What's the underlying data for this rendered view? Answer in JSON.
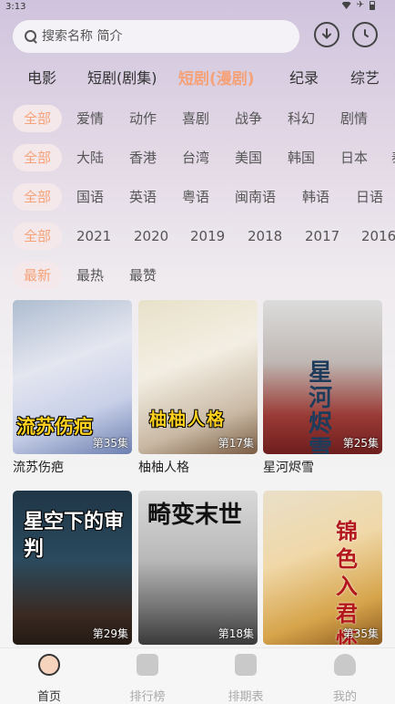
{
  "status": {
    "time": "3:13"
  },
  "search": {
    "placeholder": "搜索名称 简介"
  },
  "categories": [
    "电影",
    "短剧(剧集)",
    "短剧(漫剧)",
    "纪录",
    "综艺"
  ],
  "filters": {
    "genre": [
      "全部",
      "爱情",
      "动作",
      "喜剧",
      "战争",
      "科幻",
      "剧情"
    ],
    "region": [
      "全部",
      "大陆",
      "香港",
      "台湾",
      "美国",
      "韩国",
      "日本",
      "泰"
    ],
    "language": [
      "全部",
      "国语",
      "英语",
      "粤语",
      "闽南语",
      "韩语",
      "日语"
    ],
    "year": [
      "全部",
      "2021",
      "2020",
      "2019",
      "2018",
      "2017",
      "2016"
    ],
    "sort": [
      "最新",
      "最热",
      "最赞"
    ]
  },
  "cards": [
    {
      "title": "流苏伤疤",
      "episodes": "第35集",
      "overlay": "流苏伤疤"
    },
    {
      "title": "柚柚人格",
      "episodes": "第17集",
      "overlay": "柚柚人格"
    },
    {
      "title": "星河烬雪",
      "episodes": "第25集",
      "overlay": "星河烬雪"
    },
    {
      "title": "",
      "episodes": "第29集",
      "overlay": "星空下的审判"
    },
    {
      "title": "",
      "episodes": "第18集",
      "overlay": "畸变末世"
    },
    {
      "title": "",
      "episodes": "第35集",
      "overlay": "锦色入君怀"
    }
  ],
  "tabs": [
    "首页",
    "排行榜",
    "排期表",
    "我的"
  ],
  "colors": {
    "accent": "#f5a278",
    "chip_bg": "#f4e8ea"
  }
}
